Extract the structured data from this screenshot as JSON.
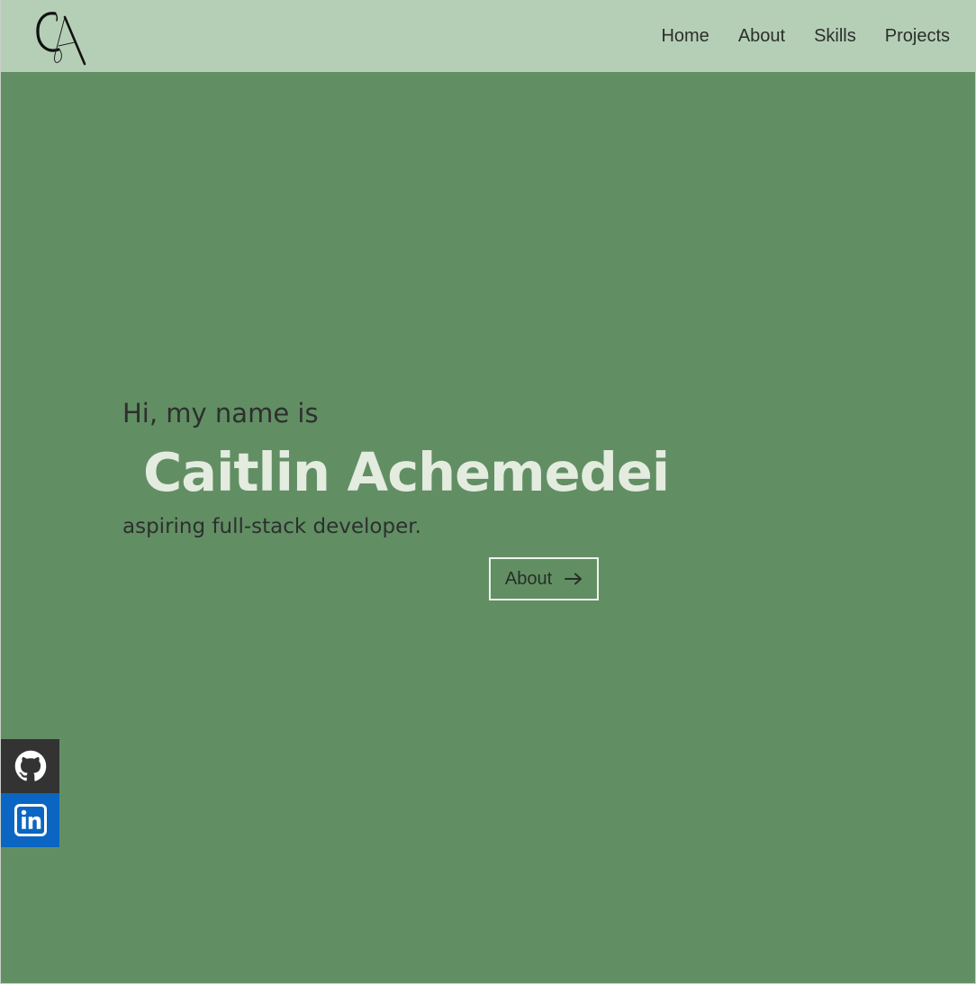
{
  "header": {
    "logo_letters": "CA",
    "nav": [
      {
        "label": "Home"
      },
      {
        "label": "About"
      },
      {
        "label": "Skills"
      },
      {
        "label": "Projects"
      }
    ]
  },
  "hero": {
    "greeting": "Hi, my name is",
    "name": "Caitlin Achemedei",
    "tagline": "aspiring full-stack developer.",
    "cta_label": "About"
  },
  "social": {
    "github_icon": "github-icon",
    "linkedin_icon": "linkedin-icon"
  },
  "colors": {
    "header_bg": "#b5cfb6",
    "page_bg": "#628e64",
    "name_color": "#e3ecdf",
    "text_color": "#2c302d",
    "github_bg": "#333333",
    "linkedin_bg": "#0a66c2"
  }
}
